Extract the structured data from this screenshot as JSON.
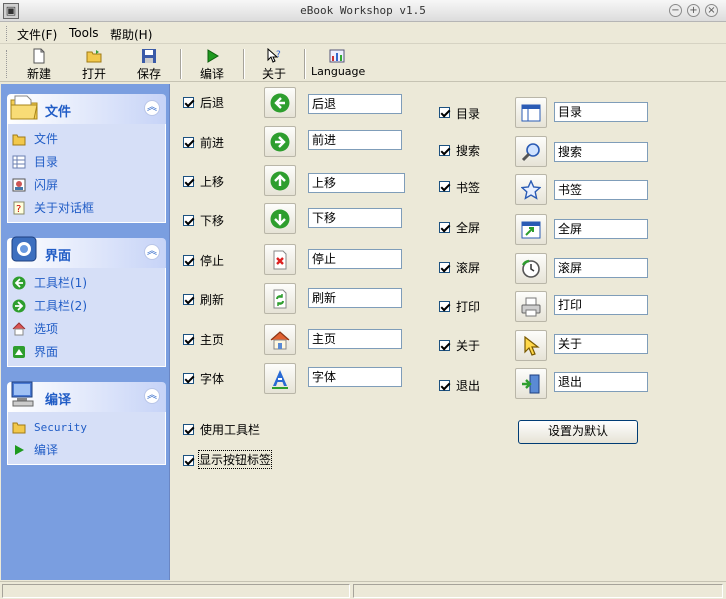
{
  "window": {
    "title": "eBook Workshop v1.5"
  },
  "menu": [
    "文件(F)",
    "Tools",
    "帮助(H)"
  ],
  "toolbar": {
    "new": "新建",
    "open": "打开",
    "save": "保存",
    "compile": "编译",
    "about": "关于",
    "language": "Language"
  },
  "sidebar": {
    "file": {
      "title": "文件",
      "items": [
        "文件",
        "目录",
        "闪屏",
        "关于对话框"
      ]
    },
    "ui": {
      "title": "界面",
      "items": [
        "工具栏(1)",
        "工具栏(2)",
        "选项",
        "界面"
      ]
    },
    "compile": {
      "title": "编译",
      "items": [
        "Security",
        "编译"
      ]
    }
  },
  "left_rows": [
    {
      "label": "后退",
      "value": "后退",
      "icon": "back-arrow-icon"
    },
    {
      "label": "前进",
      "value": "前进",
      "icon": "forward-arrow-icon"
    },
    {
      "label": "上移",
      "value": "上移",
      "icon": "up-arrow-icon"
    },
    {
      "label": "下移",
      "value": "下移",
      "icon": "down-arrow-icon"
    },
    {
      "label": "停止",
      "value": "停止",
      "icon": "stop-icon"
    },
    {
      "label": "刷新",
      "value": "刷新",
      "icon": "refresh-icon"
    },
    {
      "label": "主页",
      "value": "主页",
      "icon": "home-icon"
    },
    {
      "label": "字体",
      "value": "字体",
      "icon": "font-icon"
    }
  ],
  "right_rows": [
    {
      "label": "目录",
      "value": "目录",
      "icon": "toc-icon"
    },
    {
      "label": "搜索",
      "value": "搜索",
      "icon": "search-icon"
    },
    {
      "label": "书签",
      "value": "书签",
      "icon": "bookmark-icon"
    },
    {
      "label": "全屏",
      "value": "全屏",
      "icon": "fullscreen-icon"
    },
    {
      "label": "滚屏",
      "value": "滚屏",
      "icon": "scroll-icon"
    },
    {
      "label": "打印",
      "value": "打印",
      "icon": "print-icon"
    },
    {
      "label": "关于",
      "value": "关于",
      "icon": "about-icon"
    },
    {
      "label": "退出",
      "value": "退出",
      "icon": "exit-icon"
    }
  ],
  "options": {
    "use_toolbar": "使用工具栏",
    "show_labels": "显示按钮标签"
  },
  "default_button": "设置为默认",
  "colors": {
    "sidebar": "#7a9ee0",
    "panel_text": "#215dc6",
    "green_icon": "#2e9e2e"
  }
}
